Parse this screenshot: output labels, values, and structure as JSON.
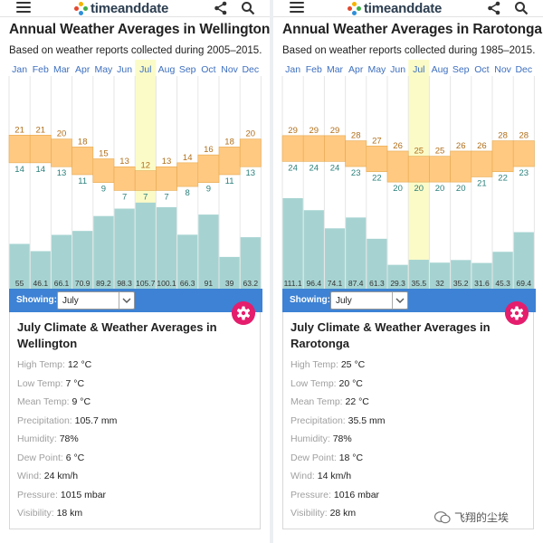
{
  "app": {
    "brand": "timeanddate",
    "icons": [
      "hamburger-menu-icon",
      "share-icon",
      "search-icon",
      "gear-icon"
    ],
    "colors": {
      "bar_band": "#ffc981",
      "bar_band_edge": "#e5a94f",
      "precip": "#a6d3d1",
      "selected_column": "#fbfbc8",
      "month_label": "#3d6fbf",
      "high_label": "#b06e1a",
      "low_label": "#2a7f7b",
      "accent_bar": "#3d82d4",
      "gear": "#e51d6d"
    }
  },
  "panels": [
    {
      "id": "wellington",
      "title": "Annual Weather Averages in Wellington",
      "subtitle": "Based on weather reports collected during 2005–2015.",
      "showing_label": "Showing:",
      "select_value": "July",
      "info_title": "July Climate & Weather Averages in Wellington",
      "details": [
        {
          "label": "High Temp:",
          "value": "12 °C"
        },
        {
          "label": "Low Temp:",
          "value": "7 °C"
        },
        {
          "label": "Mean Temp:",
          "value": "9 °C"
        },
        {
          "label": "Precipitation:",
          "value": "105.7 mm"
        },
        {
          "label": "Humidity:",
          "value": "78%"
        },
        {
          "label": "Dew Point:",
          "value": "6 °C"
        },
        {
          "label": "Wind:",
          "value": "24 km/h"
        },
        {
          "label": "Pressure:",
          "value": "1015 mbar"
        },
        {
          "label": "Visibility:",
          "value": "18 km"
        }
      ]
    },
    {
      "id": "rarotonga",
      "title": "Annual Weather Averages in Rarotonga",
      "subtitle": "Based on weather reports collected during 1985–2015.",
      "showing_label": "Showing:",
      "select_value": "July",
      "info_title": "July Climate & Weather Averages in Rarotonga",
      "details": [
        {
          "label": "High Temp:",
          "value": "25 °C"
        },
        {
          "label": "Low Temp:",
          "value": "20 °C"
        },
        {
          "label": "Mean Temp:",
          "value": "22 °C"
        },
        {
          "label": "Precipitation:",
          "value": "35.5 mm"
        },
        {
          "label": "Humidity:",
          "value": "78%"
        },
        {
          "label": "Dew Point:",
          "value": "18 °C"
        },
        {
          "label": "Wind:",
          "value": "14 km/h"
        },
        {
          "label": "Pressure:",
          "value": "1016 mbar"
        },
        {
          "label": "Visibility:",
          "value": "28 km"
        }
      ]
    }
  ],
  "chart_data": [
    {
      "type": "bar",
      "months": [
        "Jan",
        "Feb",
        "Mar",
        "Apr",
        "May",
        "Jun",
        "Jul",
        "Aug",
        "Sep",
        "Oct",
        "Nov",
        "Dec"
      ],
      "selected_month": "Jul",
      "high": [
        21,
        21,
        20,
        18,
        15,
        13,
        12,
        13,
        14,
        16,
        18,
        20
      ],
      "low": [
        14,
        14,
        13,
        11,
        9,
        7,
        7,
        7,
        8,
        9,
        11,
        13
      ],
      "precip": [
        55,
        46.1,
        66.1,
        70.9,
        89.2,
        98.3,
        105.7,
        100.1,
        66.3,
        91,
        39,
        63.2
      ],
      "precip_labels": [
        "55",
        "46.1",
        "66.1",
        "70.9",
        "89.2",
        "98.3",
        "105.7",
        "100.1",
        "66.3",
        "91",
        "39",
        "63.2"
      ],
      "temp_range": [
        0,
        30
      ],
      "precip_max": 170
    },
    {
      "type": "bar",
      "months": [
        "Jan",
        "Feb",
        "Mar",
        "Apr",
        "May",
        "Jun",
        "Jul",
        "Aug",
        "Sep",
        "Oct",
        "Nov",
        "Dec"
      ],
      "selected_month": "Jul",
      "high": [
        29,
        29,
        29,
        28,
        27,
        26,
        25,
        25,
        26,
        26,
        28,
        28
      ],
      "low": [
        24,
        24,
        24,
        23,
        22,
        20,
        20,
        20,
        20,
        21,
        22,
        23
      ],
      "precip": [
        111.1,
        96.4,
        74.1,
        87.4,
        61.3,
        29.3,
        35.5,
        32,
        35.2,
        31.6,
        45.3,
        69.4
      ],
      "precip_labels": [
        "111.1",
        "96.4",
        "74.1",
        "87.4",
        "61.3",
        "29.3",
        "35.5",
        "32",
        "35.2",
        "31.6",
        "45.3",
        "69.4"
      ],
      "temp_range": [
        13,
        36
      ],
      "precip_max": 170
    }
  ],
  "watermark": "飞翔的尘埃"
}
